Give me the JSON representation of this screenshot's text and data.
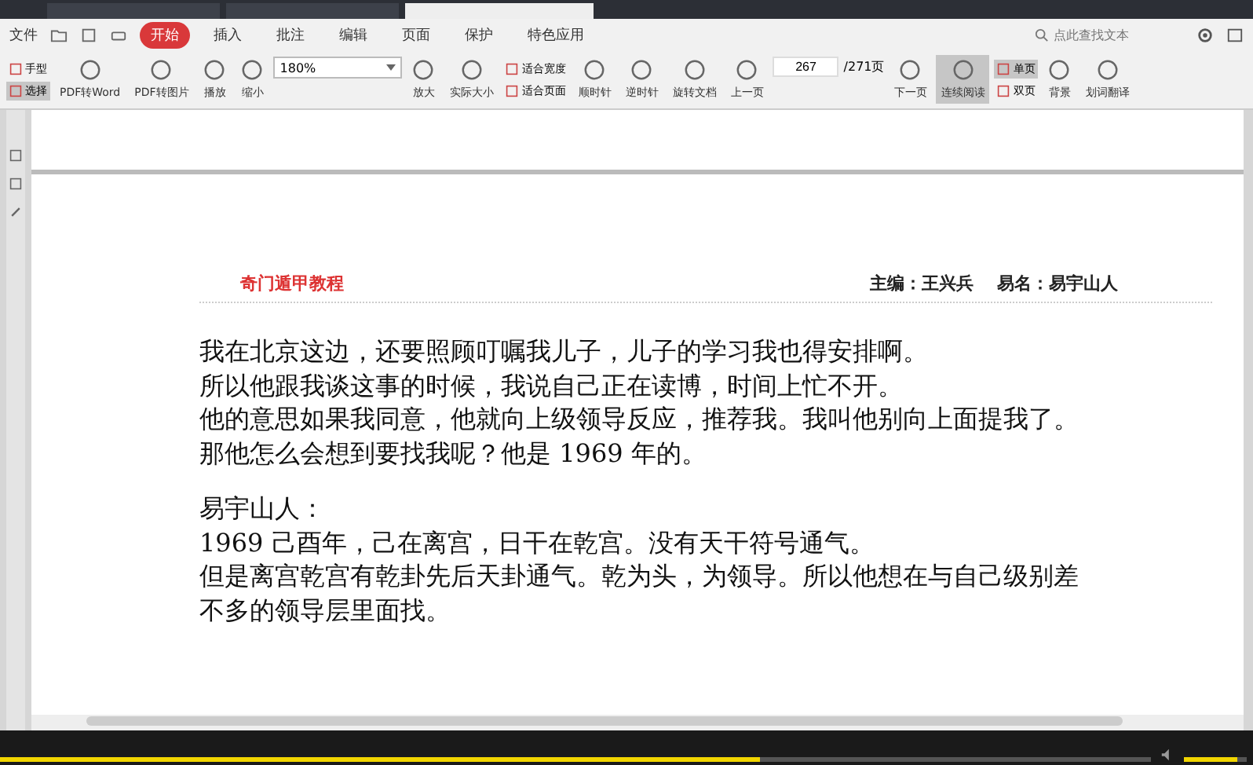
{
  "window_tabs": [
    {
      "selected": false
    },
    {
      "selected": false
    },
    {
      "selected": true
    }
  ],
  "menu": {
    "file": "文件",
    "tabs": [
      {
        "label": "开始",
        "selected": true
      },
      {
        "label": "插入",
        "selected": false
      },
      {
        "label": "批注",
        "selected": false
      },
      {
        "label": "编辑",
        "selected": false
      },
      {
        "label": "页面",
        "selected": false
      },
      {
        "label": "保护",
        "selected": false
      },
      {
        "label": "特色应用",
        "selected": false
      }
    ],
    "search": {
      "placeholder": "点此查找文本"
    }
  },
  "toolbar": [
    {
      "kind": "pair",
      "items": [
        {
          "label": "手型",
          "selected": false
        },
        {
          "label": "选择",
          "selected": true
        }
      ]
    },
    {
      "kind": "big",
      "label": "PDF转Word",
      "selected": false
    },
    {
      "kind": "big",
      "label": "PDF转图片",
      "selected": false
    },
    {
      "kind": "big",
      "label": "播放",
      "selected": false
    },
    {
      "kind": "big",
      "label": "缩小",
      "selected": false
    },
    {
      "kind": "zoom",
      "value": "180%"
    },
    {
      "kind": "big",
      "label": "放大",
      "selected": false
    },
    {
      "kind": "big",
      "label": "实际大小",
      "selected": false
    },
    {
      "kind": "pair",
      "items": [
        {
          "label": "适合宽度",
          "selected": false
        },
        {
          "label": "适合页面",
          "selected": false
        }
      ]
    },
    {
      "kind": "big",
      "label": "顺时针",
      "selected": false
    },
    {
      "kind": "big",
      "label": "逆时针",
      "selected": false
    },
    {
      "kind": "big",
      "label": "旋转文档",
      "selected": false
    },
    {
      "kind": "big",
      "label": "上一页",
      "selected": false
    },
    {
      "kind": "page",
      "value": "267",
      "total": "/271页"
    },
    {
      "kind": "big",
      "label": "下一页",
      "selected": false
    },
    {
      "kind": "big",
      "label": "连续阅读",
      "selected": true
    },
    {
      "kind": "pair",
      "items": [
        {
          "label": "单页",
          "selected": true
        },
        {
          "label": "双页",
          "selected": false
        }
      ]
    },
    {
      "kind": "big",
      "label": "背景",
      "selected": false
    },
    {
      "kind": "big",
      "label": "划词翻译",
      "selected": false
    }
  ],
  "document": {
    "header_left": "奇门遁甲教程",
    "header_right": "主编：王兴兵　 易名：易宇山人",
    "paragraphs": [
      [
        "我在北京这边，还要照顾叮嘱我儿子，儿子的学习我也得安排啊。",
        "所以他跟我谈这事的时候，我说自己正在读博，时间上忙不开。",
        "他的意思如果我同意，他就向上级领导反应，推荐我。我叫他别向上面提我了。",
        "那他怎么会想到要找我呢？他是 1969 年的。"
      ],
      [
        "易宇山人：",
        "1969 己酉年，己在离宫，日干在乾宫。没有天干符号通气。",
        "但是离宫乾宫有乾卦先后天卦通气。乾为头，为领导。所以他想在与自己级别差",
        "不多的领导层里面找。"
      ]
    ]
  },
  "video": {
    "progress": {
      "level": 0.66
    },
    "volume": {
      "level": 0.85
    }
  }
}
